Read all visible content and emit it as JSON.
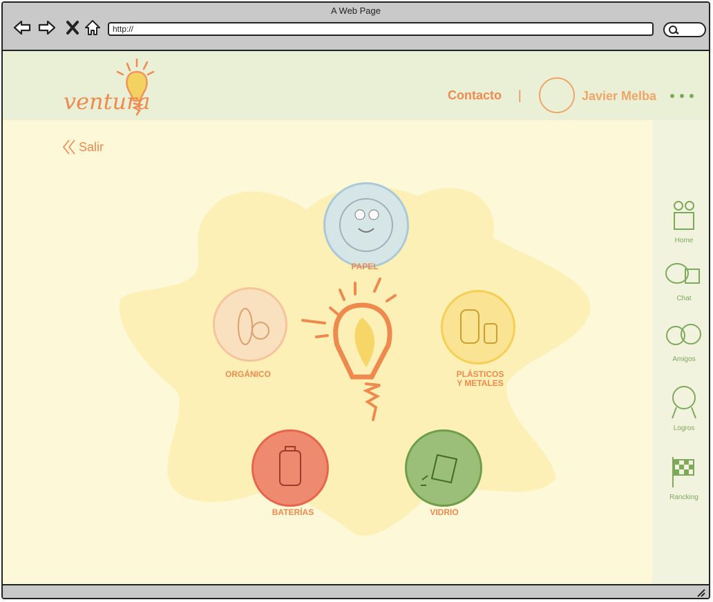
{
  "browser": {
    "title": "A Web Page",
    "url": "http://"
  },
  "header": {
    "logo_text": "ventura",
    "contacto": "Contacto",
    "separator": "|",
    "user_name": "Javier Melba"
  },
  "exit_label": "Salir",
  "categories": {
    "papel": "PAPEL",
    "organico": "ORGÁNICO",
    "plasticos_line1": "PLÁSTICOS",
    "plasticos_line2": "Y METALES",
    "baterias": "BATERÍAS",
    "vidrio": "VIDRIO"
  },
  "sidebar": {
    "items": [
      {
        "label": "Home"
      },
      {
        "label": "Chat"
      },
      {
        "label": "Amigos"
      },
      {
        "label": "Logros"
      },
      {
        "label": "Rancking"
      }
    ]
  },
  "colors": {
    "orange": "#ee8a4e",
    "green": "#7ea85a",
    "blue": "#a9c9d8",
    "yellow": "#f5cf55",
    "red": "#e8644a",
    "peach": "#f6c49a"
  }
}
